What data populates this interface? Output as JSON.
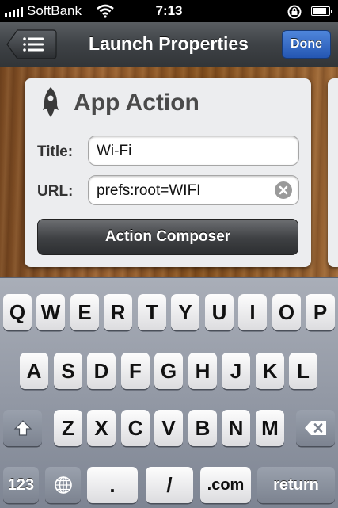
{
  "status_bar": {
    "carrier": "SoftBank",
    "time": "7:13",
    "battery_level": 0.9
  },
  "nav": {
    "title": "Launch Properties",
    "done_label": "Done"
  },
  "card": {
    "title": "App Action",
    "title_field_label": "Title:",
    "title_field_value": "Wi-Fi",
    "url_field_label": "URL:",
    "url_field_value": "prefs:root=WIFI",
    "composer_label": "Action Composer"
  },
  "keyboard": {
    "row1": [
      "Q",
      "W",
      "E",
      "R",
      "T",
      "Y",
      "U",
      "I",
      "O",
      "P"
    ],
    "row2": [
      "A",
      "S",
      "D",
      "F",
      "G",
      "H",
      "J",
      "K",
      "L"
    ],
    "row3": [
      "Z",
      "X",
      "C",
      "V",
      "B",
      "N",
      "M"
    ],
    "numbers_label": "123",
    "dot_label": ".",
    "slash_label": "/",
    "dotcom_label": ".com",
    "return_label": "return"
  },
  "colors": {
    "done_button": "#2f63c0",
    "keyboard_bg": "#8f96a3"
  }
}
